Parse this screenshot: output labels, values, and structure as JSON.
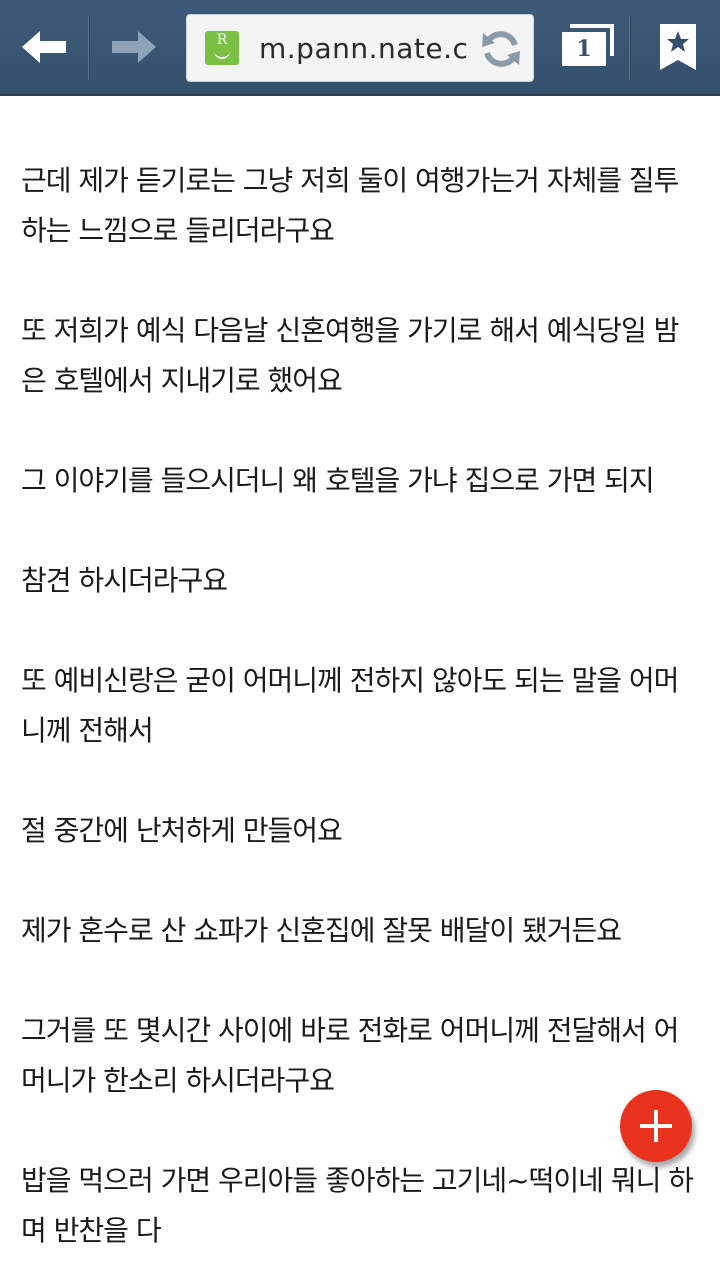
{
  "browser": {
    "url": "m.pann.nate.c",
    "favicon_letter": "R",
    "tab_count": "1",
    "accent_color": "#34506c"
  },
  "article": {
    "paragraphs": [
      "근데 제가 듣기로는 그냥 저희 둘이 여행가는거 자체를 질투하는 느낌으로 들리더라구요",
      "또 저희가 예식 다음날 신혼여행을 가기로 해서 예식당일 밤은 호텔에서 지내기로 했어요",
      "그 이야기를 들으시더니 왜 호텔을 가냐 집으로 가면 되지",
      "참견 하시더라구요",
      "또 예비신랑은 굳이 어머니께 전하지 않아도 되는 말을 어머니께 전해서",
      "절 중간에 난처하게 만들어요",
      "제가 혼수로 산 쇼파가 신혼집에 잘못 배달이 됐거든요",
      "그거를 또 몇시간 사이에 바로 전화로 어머니께 전달해서 어머니가 한소리 하시더라구요",
      "밥을 먹으러 가면 우리아들 좋아하는 고기네~떡이네 뭐니 하며 반찬을 다"
    ]
  },
  "fab": {
    "icon": "plus-icon",
    "color": "#e8321e"
  }
}
